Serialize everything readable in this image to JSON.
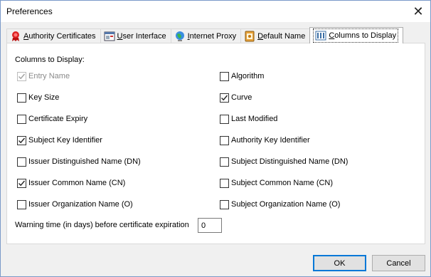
{
  "window": {
    "title": "Preferences",
    "close_glyph": "✕"
  },
  "tabs": [
    {
      "mnemonic": "A",
      "rest": "uthority Certificates",
      "icon": "ribbon-icon"
    },
    {
      "mnemonic": "U",
      "rest": "ser Interface",
      "icon": "window-icon"
    },
    {
      "mnemonic": "I",
      "rest": "nternet Proxy",
      "icon": "globe-icon"
    },
    {
      "mnemonic": "D",
      "rest": "efault Name",
      "icon": "name-tag-icon"
    },
    {
      "mnemonic": "C",
      "rest": "olumns to Display",
      "icon": "columns-icon",
      "active": true
    }
  ],
  "columns": {
    "heading": "Columns to Display:",
    "left": [
      {
        "label": "Entry Name",
        "checked": true,
        "disabled": true
      },
      {
        "label": "Key Size",
        "checked": false
      },
      {
        "label": "Certificate Expiry",
        "checked": false
      },
      {
        "label": "Subject Key Identifier",
        "checked": true
      },
      {
        "label": "Issuer Distinguished Name (DN)",
        "checked": false
      },
      {
        "label": "Issuer Common Name (CN)",
        "checked": true
      },
      {
        "label": "Issuer Organization Name (O)",
        "checked": false
      }
    ],
    "right": [
      {
        "label": "Algorithm",
        "checked": false
      },
      {
        "label": "Curve",
        "checked": true
      },
      {
        "label": "Last Modified",
        "checked": false
      },
      {
        "label": "Authority Key Identifier",
        "checked": false
      },
      {
        "label": "Subject Distinguished Name (DN)",
        "checked": false
      },
      {
        "label": "Subject Common Name (CN)",
        "checked": false
      },
      {
        "label": "Subject Organization Name (O)",
        "checked": false
      }
    ]
  },
  "warning": {
    "label": "Warning time (in days) before certificate expiration",
    "value": "0"
  },
  "buttons": {
    "ok": "OK",
    "cancel": "Cancel"
  }
}
